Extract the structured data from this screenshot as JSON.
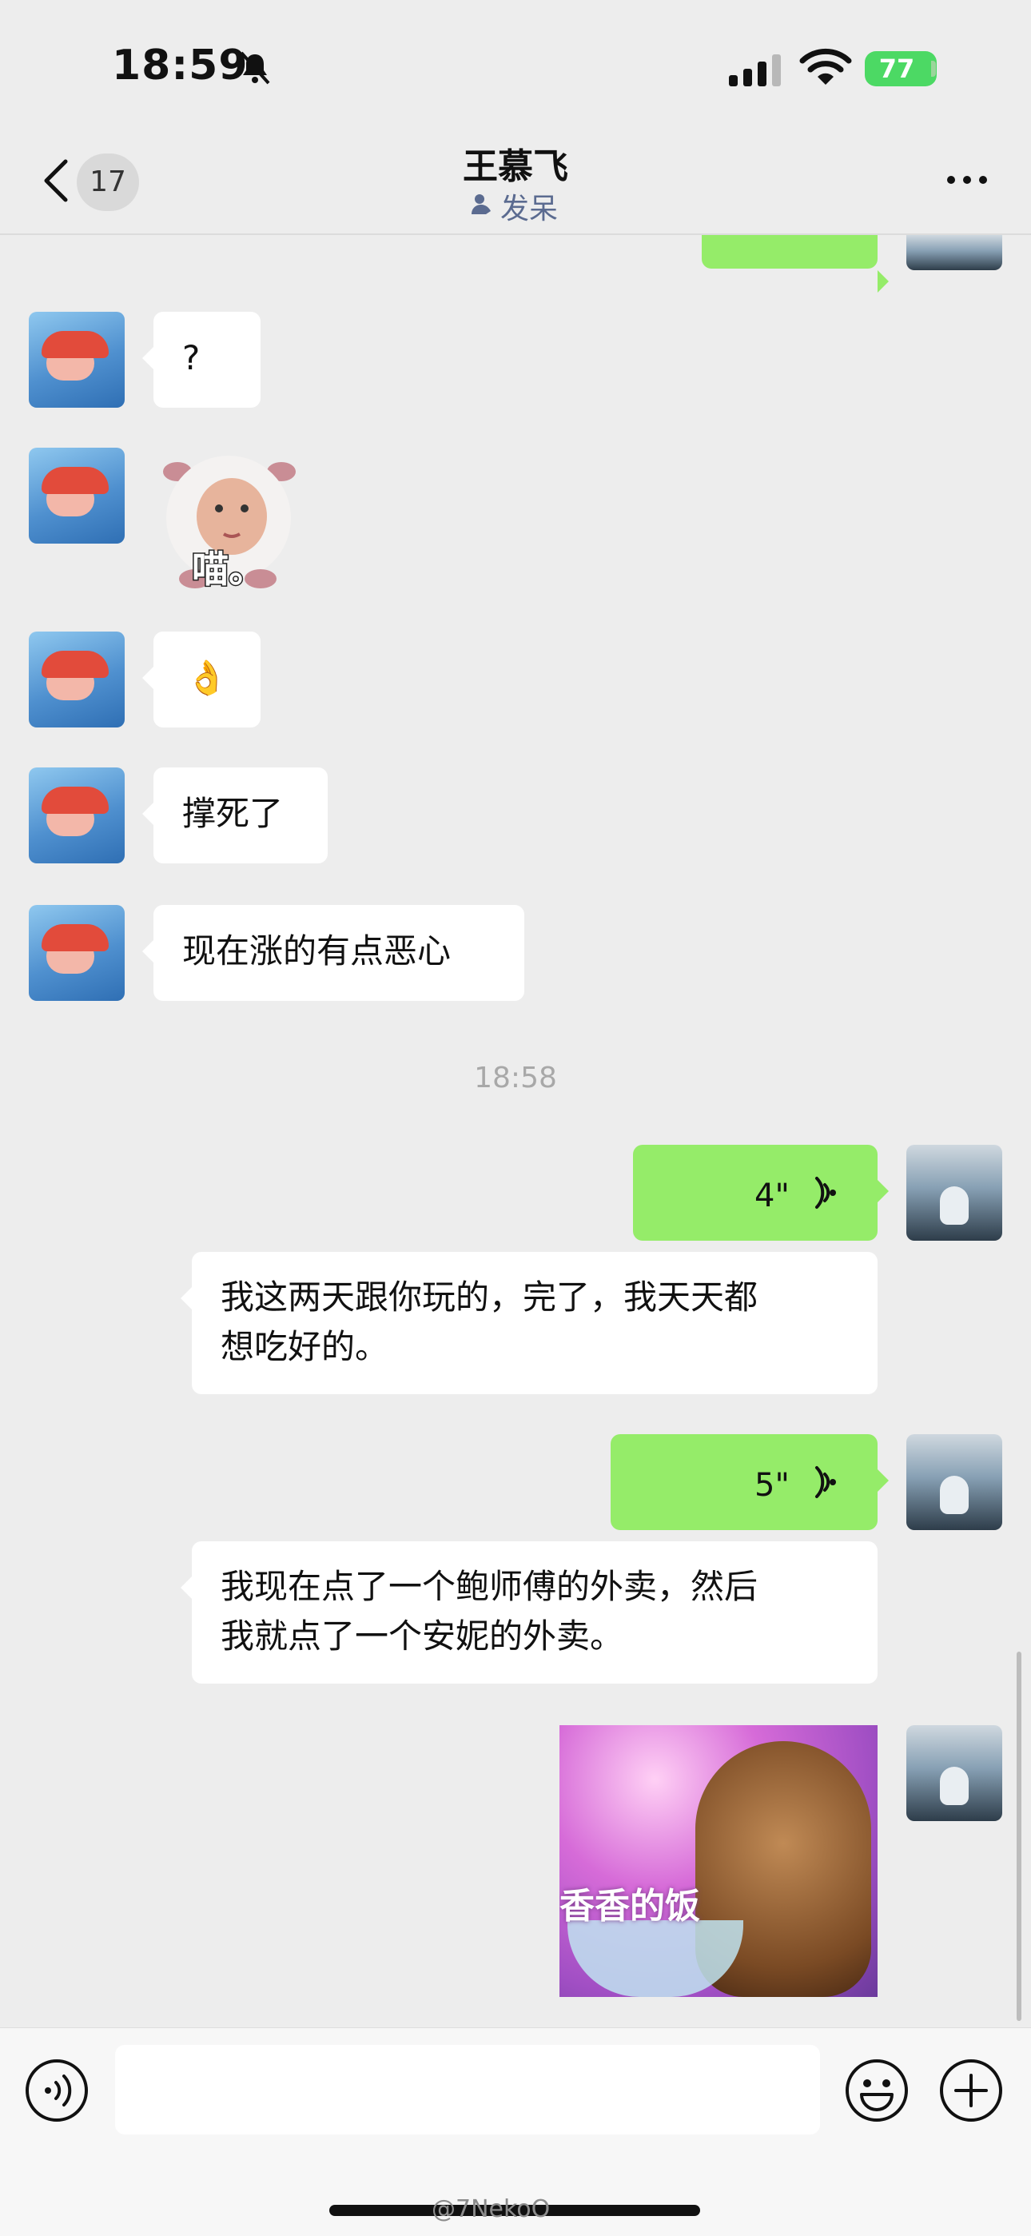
{
  "status_bar": {
    "time": "18:59",
    "battery": "77"
  },
  "nav": {
    "unread_count": "17",
    "contact_name": "王慕飞",
    "contact_status": "发呆"
  },
  "messages": {
    "m1": "?",
    "m3": "👌",
    "m4": "撑死了",
    "m5": "现在涨的有点恶心",
    "timestamp": "18:58",
    "v1_duration": "4\"",
    "v1_transcript_line1": "我这两天跟你玩的，完了，我天天都",
    "v1_transcript_line2": "想吃好的。",
    "v2_duration": "5\"",
    "v2_transcript_line1": "我现在点了一个鲍师傅的外卖，然后",
    "v2_transcript_line2": "我就点了一个安妮的外卖。"
  },
  "stickers": {
    "cat_meow_text": "喵。",
    "dog_text": "香香的饭"
  },
  "input": {
    "placeholder": ""
  },
  "footer": {
    "watermark": "@7NekoO"
  },
  "colors": {
    "outgoing_bubble": "#95ec69",
    "incoming_bubble": "#ffffff",
    "background": "#ededed",
    "badge": "#d9d9d9",
    "battery": "#4cd964"
  },
  "icons": [
    "bell-mute-icon",
    "signal-icon",
    "wifi-icon",
    "battery-icon",
    "back-chevron-icon",
    "more-dots-icon",
    "voice-input-icon",
    "emoji-icon",
    "plus-icon",
    "voice-wave-icon"
  ]
}
